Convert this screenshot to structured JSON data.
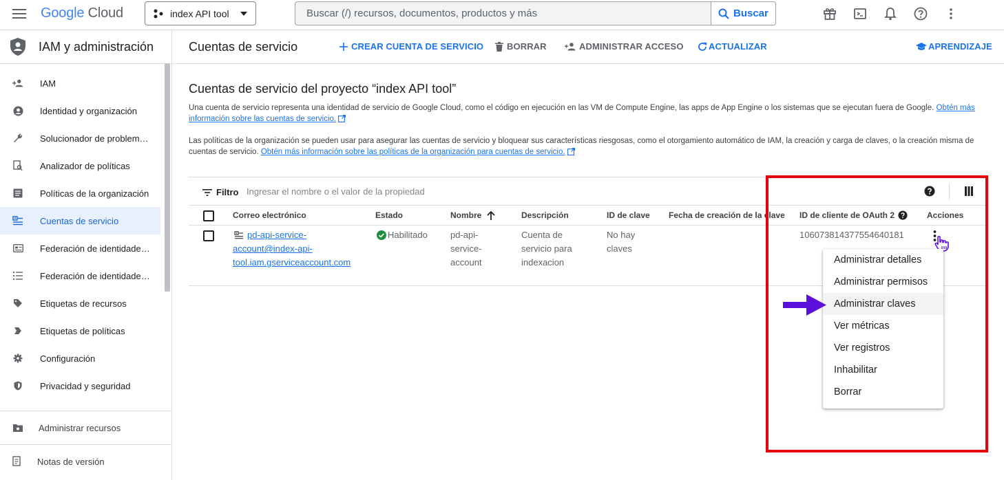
{
  "topbar": {
    "brand_google": "Google",
    "brand_cloud": "Cloud",
    "project": "index API tool",
    "search_placeholder": "Buscar (/) recursos, documentos, productos y más",
    "search_button": "Buscar"
  },
  "sidebar": {
    "title": "IAM y administración",
    "items": [
      {
        "label": "IAM",
        "icon": "person-add-icon"
      },
      {
        "label": "Identidad y organización",
        "icon": "account-circle-icon"
      },
      {
        "label": "Solucionador de problem…",
        "icon": "wrench-icon"
      },
      {
        "label": "Analizador de políticas",
        "icon": "policy-search-icon"
      },
      {
        "label": "Políticas de la organización",
        "icon": "list-doc-icon"
      },
      {
        "label": "Cuentas de servicio",
        "icon": "service-account-icon",
        "active": true
      },
      {
        "label": "Federación de identidade…",
        "icon": "id-card-icon"
      },
      {
        "label": "Federación de identidade…",
        "icon": "list-icon"
      },
      {
        "label": "Etiquetas de recursos",
        "icon": "tag-icon"
      },
      {
        "label": "Etiquetas de políticas",
        "icon": "label-arrow-icon"
      },
      {
        "label": "Configuración",
        "icon": "gear-icon"
      },
      {
        "label": "Privacidad y seguridad",
        "icon": "shield-icon"
      }
    ],
    "footer_manage": "Administrar recursos",
    "footer_notes": "Notas de versión"
  },
  "header": {
    "title": "Cuentas de servicio",
    "create": "CREAR CUENTA DE SERVICIO",
    "delete": "BORRAR",
    "manage_access": "ADMINISTRAR ACCESO",
    "refresh": "ACTUALIZAR",
    "learn": "APRENDIZAJE"
  },
  "content": {
    "heading": "Cuentas de servicio del proyecto “index API tool”",
    "para1": "Una cuenta de servicio representa una identidad de servicio de Google Cloud, como el código en ejecución en las VM de Compute Engine, las apps de App Engine o los sistemas que se ejecutan fuera de Google.",
    "para1_link": "Obtén más información sobre las cuentas de servicio.",
    "para2": "Las políticas de la organización se pueden usar para asegurar las cuentas de servicio y bloquear sus características riesgosas, como el otorgamiento automático de IAM, la creación y carga de claves, o la creación misma de cuentas de servicio.",
    "para2_link": "Obtén más información sobre las políticas de la organización para cuentas de servicio."
  },
  "table": {
    "filter_label": "Filtro",
    "filter_placeholder": "Ingresar el nombre o el valor de la propiedad",
    "columns": [
      "Correo electrónico",
      "Estado",
      "Nombre",
      "Descripción",
      "ID de clave",
      "Fecha de creación de la clave",
      "ID de cliente de OAuth 2",
      "Acciones"
    ],
    "rows": [
      {
        "email": [
          "pd-api-service-",
          "account@index-api-",
          "tool.iam.gserviceaccount.com"
        ],
        "status": "Habilitado",
        "name": [
          "pd-api-",
          "service-",
          "account"
        ],
        "description": [
          "Cuenta de",
          "servicio para",
          "indexacion"
        ],
        "key_id": [
          "No hay",
          "claves"
        ],
        "key_date": "",
        "oauth_id": "106073814377554640181"
      }
    ]
  },
  "menu": {
    "items": [
      "Administrar detalles",
      "Administrar permisos",
      "Administrar claves",
      "Ver métricas",
      "Ver registros",
      "Inhabilitar",
      "Borrar"
    ],
    "highlighted_index": 2
  },
  "colors": {
    "accent": "#1a73e8",
    "annotation_red": "#e8000b",
    "annotation_arrow": "#5b0fd8",
    "status_green": "#1e8e3e"
  }
}
